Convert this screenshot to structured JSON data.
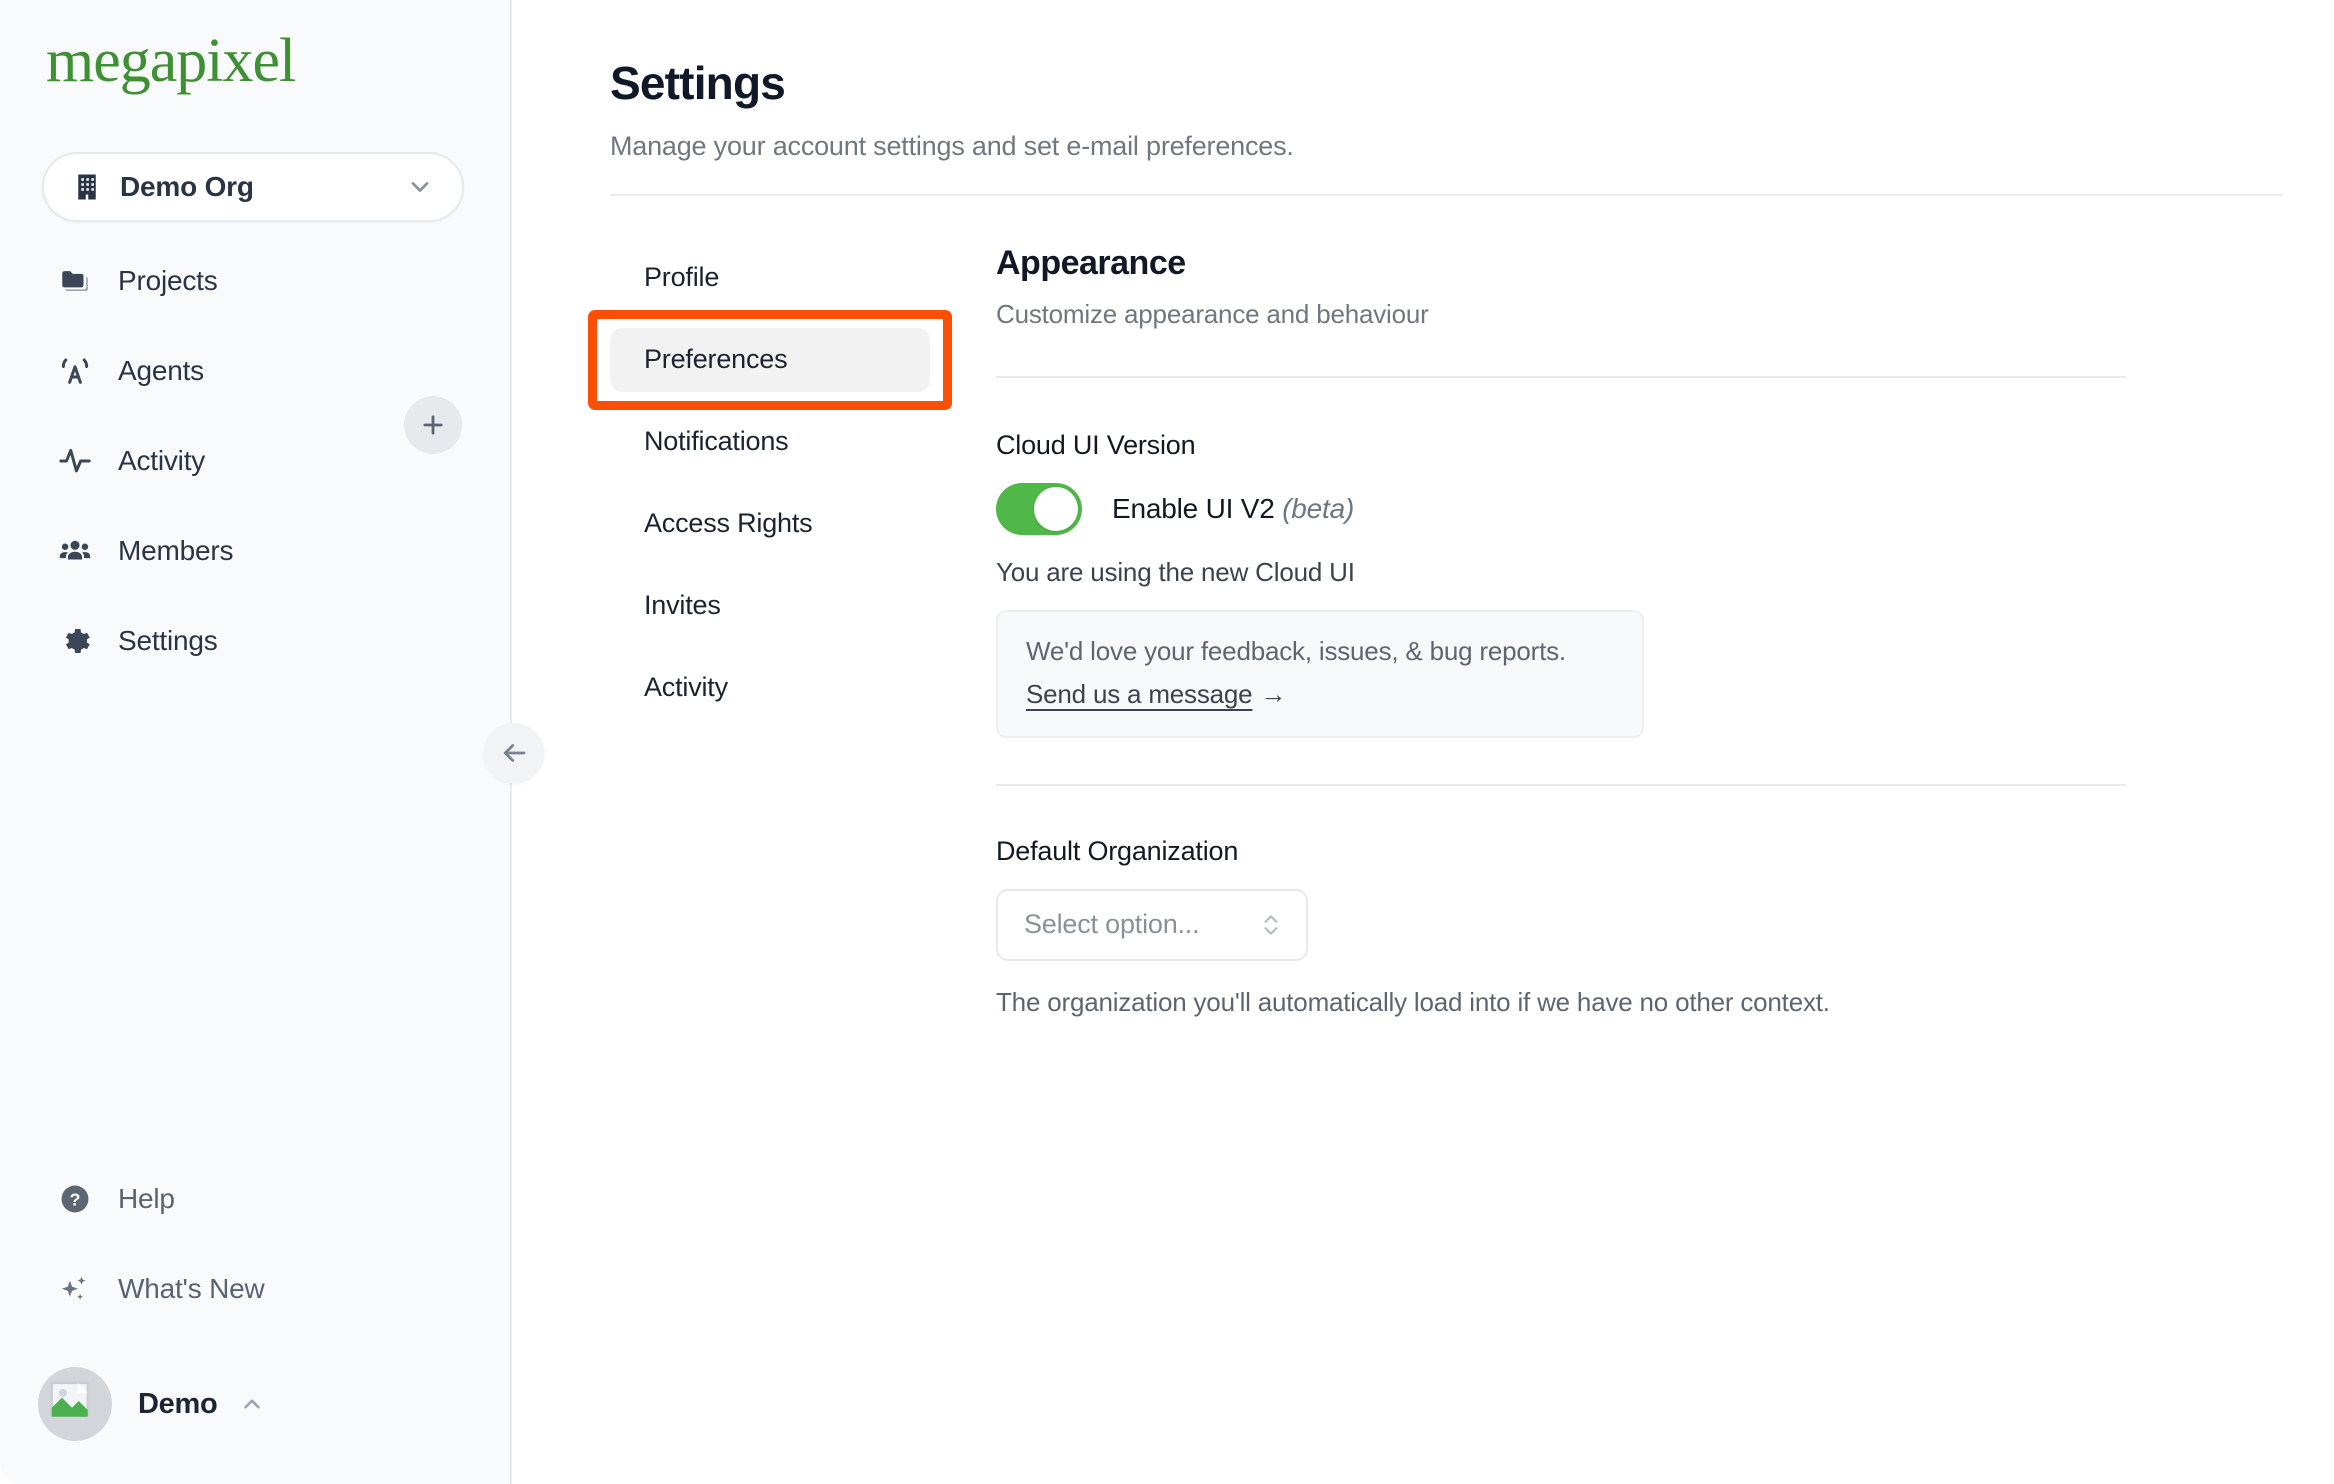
{
  "brand": {
    "logo_text": "megapixel",
    "logo_color": "#3f8f33"
  },
  "sidebar": {
    "org_switcher": {
      "name": "Demo Org",
      "icon": "building-icon",
      "chevron": "chevron-down-icon"
    },
    "items": [
      {
        "label": "Projects",
        "icon": "folder-icon"
      },
      {
        "label": "Agents",
        "icon": "broadcast-antenna-icon"
      },
      {
        "label": "Activity",
        "icon": "pulse-icon"
      },
      {
        "label": "Members",
        "icon": "people-icon"
      },
      {
        "label": "Settings",
        "icon": "gear-icon"
      }
    ],
    "add_agent_label": "+",
    "collapse_label": "←",
    "bottom_items": [
      {
        "label": "Help",
        "icon": "question-circle-icon"
      },
      {
        "label": "What's New",
        "icon": "sparkles-icon"
      }
    ],
    "user": {
      "name": "Demo",
      "avatar": "broken-image-avatar",
      "caret": "chevron-up-icon"
    }
  },
  "header": {
    "title": "Settings",
    "subtitle": "Manage your account settings and set e-mail preferences."
  },
  "tabs": [
    {
      "label": "Profile",
      "active": false
    },
    {
      "label": "Preferences",
      "active": true
    },
    {
      "label": "Notifications",
      "active": false
    },
    {
      "label": "Access Rights",
      "active": false
    },
    {
      "label": "Invites",
      "active": false
    },
    {
      "label": "Activity",
      "active": false
    }
  ],
  "annotation": {
    "color": "#fb4f08",
    "target": "Preferences"
  },
  "appearance": {
    "title": "Appearance",
    "subtitle": "Customize appearance and behaviour",
    "cloud_ui": {
      "label": "Cloud UI Version",
      "toggle_on": true,
      "toggle_color": "#4fb848",
      "toggle_label": "Enable UI V2",
      "toggle_label_suffix": "(beta)",
      "status": "You are using the new Cloud UI",
      "feedback_text": "We'd love your feedback, issues, & bug reports.",
      "feedback_link": "Send us a message",
      "feedback_arrow": "→"
    },
    "default_org": {
      "label": "Default Organization",
      "select_value": "Select option...",
      "helper": "The organization you'll automatically load into if we have no other context."
    }
  }
}
